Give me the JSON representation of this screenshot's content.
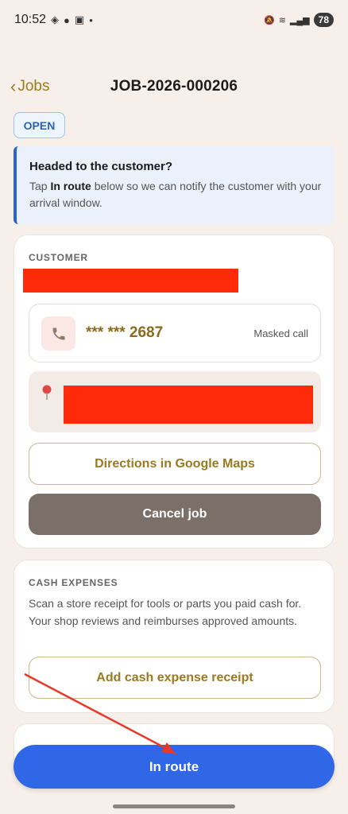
{
  "status_bar": {
    "time": "10:52",
    "battery": "78"
  },
  "header": {
    "back_label": "Jobs",
    "title": "JOB-2026-000206"
  },
  "status_badge": "OPEN",
  "banner": {
    "title": "Headed to the customer?",
    "body_prefix": "Tap ",
    "body_bold": "In route",
    "body_suffix": " below so we can notify the customer with your arrival window."
  },
  "customer": {
    "section_label": "CUSTOMER",
    "phone": "*** *** 2687",
    "masked_call": "Masked call",
    "directions_label": "Directions in Google Maps",
    "cancel_label": "Cancel job"
  },
  "cash": {
    "section_label": "CASH EXPENSES",
    "description": "Scan a store receipt for tools or parts you paid cash for. Your shop reviews and reimburses approved amounts.",
    "add_label": "Add cash expense receipt"
  },
  "primary_action": "In route",
  "icons": {
    "phone": "phone-icon",
    "pin": "map-pin-icon",
    "back": "chevron-left-icon"
  },
  "colors": {
    "accent_gold": "#9b7a1f",
    "primary_blue": "#2f67e6",
    "badge_blue": "#2a64b7",
    "redaction": "#ff2a0a",
    "annotation_arrow": "#e53a2a"
  }
}
